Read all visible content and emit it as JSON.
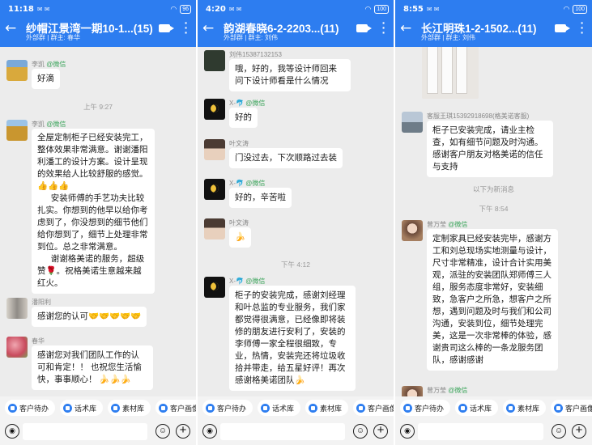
{
  "panels": [
    {
      "status": {
        "time": "11:18",
        "battery": "96"
      },
      "header": {
        "title": "纱帽江景湾一期10-1...(15)",
        "subtitle": "外部群 | 群主: 春华"
      },
      "messages": [
        {
          "sender": "李凯",
          "tag": "@微信",
          "text": "好滴"
        },
        {
          "time": "上午 9:27"
        },
        {
          "sender": "李凯",
          "tag": "@微信",
          "lines": [
            "全屋定制柜子已经安装完工，整体效果非常满意。谢谢潘阳利潘工的设计方案。设计呈现的效果给人比较舒服的感觉。",
            "👍👍👍",
            "安装师傅的手艺功夫比较扎实。你想到的他早以给你考虑到了，你没想到的细节他们给你想到了，细节上处理非常到位。总之非常满意。",
            "谢谢格美诺的服务，超级赞🌹。祝格美诺生意越来越红火。"
          ]
        },
        {
          "sender": "潘阳利",
          "text": "感谢您的认可🤝🤝🤝🤝🤝"
        },
        {
          "sender": "春华",
          "text": "感谢您对我们团队工作的认可和肯定！！ 也祝您生活愉快，事事顺心！ 🍌🍌🍌"
        }
      ],
      "toolbar": [
        "客户待办",
        "话术库",
        "素材库",
        "客户画像"
      ]
    },
    {
      "status": {
        "time": "4:20",
        "battery": "100"
      },
      "header": {
        "title": "韵湖春晓6-2-2203...(11)",
        "subtitle": "外部群 | 群主: 刘伟"
      },
      "messages": [
        {
          "sender": "刘伟15387132153",
          "tag": "",
          "text": "哦，好的，我等设计师回来问下设计师看是什么情况"
        },
        {
          "sender": "X-🐬",
          "tag": "@微信",
          "text": "好的"
        },
        {
          "sender": "叶文涛",
          "tag": "",
          "text": "门没过去，下次顺路过去装"
        },
        {
          "sender": "X-🐬",
          "tag": "@微信",
          "text": "好的，辛苦啦"
        },
        {
          "sender": "叶文涛",
          "tag": "",
          "text": "🍌"
        },
        {
          "time": "下午 4:12"
        },
        {
          "sender": "X-🐬",
          "tag": "@微信",
          "text": "柜子的安装完成，感谢刘经理和叶总监的专业服务，我们家都觉得很满意，已经像即将装修的朋友进行安利了，安装的李师傅一家全程很细致，专业，热情，安装完还将垃圾收拾并带走，给五星好评！再次感谢格美诺团队🍌"
        }
      ],
      "toolbar": [
        "客户待办",
        "话术库",
        "素材库",
        "客户画像"
      ]
    },
    {
      "status": {
        "time": "8:55",
        "battery": "100"
      },
      "header": {
        "title": "长江明珠1-2-1502...(11)",
        "subtitle": "外部群 | 群主: 刘伟"
      },
      "messages": [
        {
          "sender": "客服王琪15392918698(格美诺客服)",
          "tag": "",
          "text": "柜子已安装完成，请业主检查，如有细节问题及时沟通。感谢客户朋友对格美诺的信任与支持"
        },
        {
          "notice": "以下为新消息"
        },
        {
          "time": "下午 8:54"
        },
        {
          "sender": "曾万莹",
          "tag": "@微信",
          "text": "定制家具已经安装完毕，感谢方工和刘总现场实地测量与设计，尺寸非常精准，设计合计实用美观，派驻的安装团队郑师傅三人组，服务态度非常好，安装细致，急客户之所急，想客户之所想，遇到问题及时与我们和公司沟通，安装到位，细节处理完美，这是一次非常棒的体验，感谢贵司这么棒的一条龙服务团队，感谢感谢"
        },
        {
          "sender": "曾万莹",
          "tag": "@微信"
        }
      ],
      "toolbar": [
        "客户待办",
        "话术库",
        "素材库",
        "客户画像"
      ]
    }
  ]
}
